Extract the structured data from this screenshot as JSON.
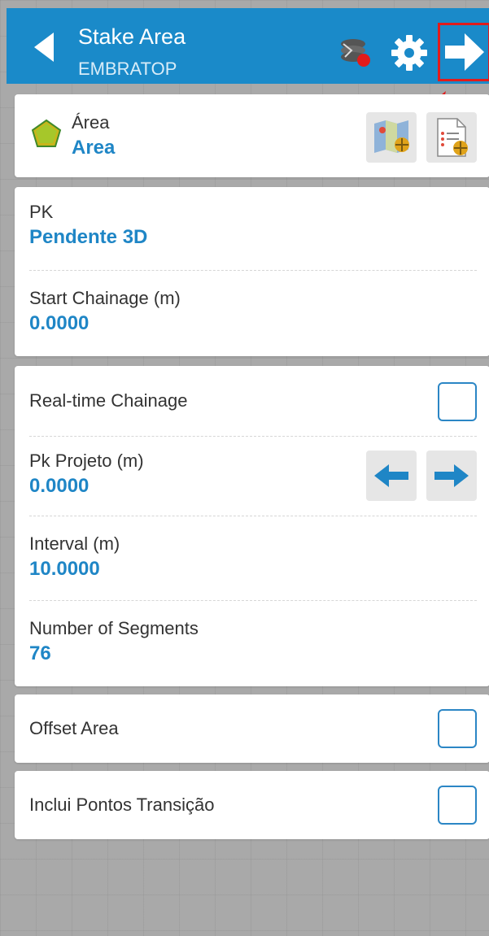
{
  "header": {
    "title": "Stake Area",
    "subtitle": "EMBRATOP",
    "accent_color": "#1a8ac9",
    "icons": [
      "back-arrow-icon",
      "survey-status-icon",
      "gear-icon",
      "next-arrow-icon"
    ]
  },
  "area_card": {
    "label": "Área",
    "value": "Area",
    "icons": [
      "polygon-icon",
      "map-select-icon",
      "list-select-icon"
    ]
  },
  "pk_card": {
    "pk_label": "PK",
    "pk_value": "Pendente 3D",
    "start_chainage_label": "Start Chainage (m)",
    "start_chainage_value": "0.0000"
  },
  "chainage_card": {
    "realtime_label": "Real-time Chainage",
    "realtime_checked": false,
    "pk_projeto_label": "Pk Projeto (m)",
    "pk_projeto_value": "0.0000",
    "interval_label": "Interval (m)",
    "interval_value": "10.0000",
    "segments_label": "Number of Segments",
    "segments_value": "76"
  },
  "offset_card": {
    "label": "Offset Area",
    "checked": false
  },
  "transition_card": {
    "label": "Inclui Pontos Transição",
    "checked": false
  },
  "colors": {
    "value_blue": "#1f86c6",
    "highlight_red": "#e21b1b"
  }
}
